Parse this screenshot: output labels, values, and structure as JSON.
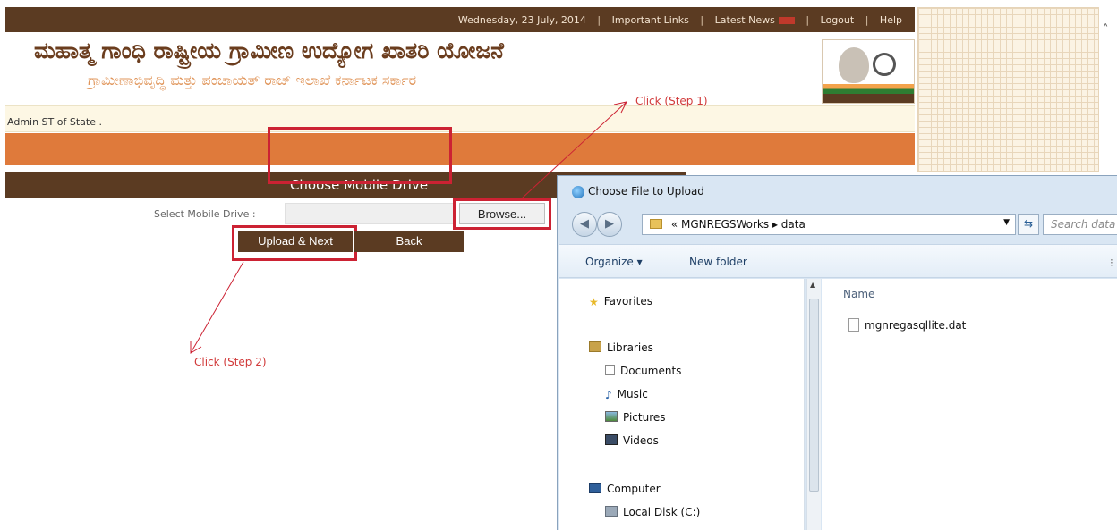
{
  "topbar": {
    "date": "Wednesday, 23 July, 2014",
    "links": [
      "Important Links",
      "Latest News",
      "Logout",
      "Help"
    ]
  },
  "header": {
    "title": "ಮಹಾತ್ಮ ಗಾಂಧಿ ರಾಷ್ಟ್ರೀಯ ಗ್ರಾಮೀಣ ಉದ್ಯೋಗ ಖಾತರಿ ಯೋಜನೆ",
    "subtitle": "ಗ್ರಾಮೀಣಾಭಿವೃದ್ಧಿ ಮತ್ತು ಪಂಚಾಯತ್ ರಾಜ್ ಇಲಾಖೆ ಕರ್ನಾಟಕ ಸರ್ಕಾರ",
    "user": "Admin ST of State ."
  },
  "drive_panel": {
    "title": "Choose Mobile Drive",
    "label": "Select Mobile Drive :",
    "input_value": "",
    "browse": "Browse...",
    "upload": "Upload & Next",
    "back": "Back"
  },
  "annotations": {
    "step1": "Click (Step 1)",
    "step2": "Click (Step 2)",
    "color": "#cc2233"
  },
  "dialog": {
    "title": "Choose File to Upload",
    "path_prefix": "«",
    "path": [
      "MGNREGSWorks",
      "data"
    ],
    "path_sep": "▸",
    "search_placeholder": "Search data",
    "organize": "Organize ▾",
    "new_folder": "New folder",
    "nav": {
      "favorites": "Favorites",
      "libraries": "Libraries",
      "documents": "Documents",
      "music": "Music",
      "pictures": "Pictures",
      "videos": "Videos",
      "computer": "Computer",
      "local_disk": "Local Disk (C:)"
    },
    "column_name": "Name",
    "file": "mgnregasqllite.dat"
  },
  "colors": {
    "brown": "#5b3b22",
    "orange": "#df7a3b",
    "dialog_frame": "#d9e6f3"
  },
  "icons": [
    "star-icon",
    "library-icon",
    "document-icon",
    "music-icon",
    "picture-icon",
    "video-icon",
    "computer-icon",
    "drive-icon",
    "folder-icon",
    "refresh-icon"
  ]
}
